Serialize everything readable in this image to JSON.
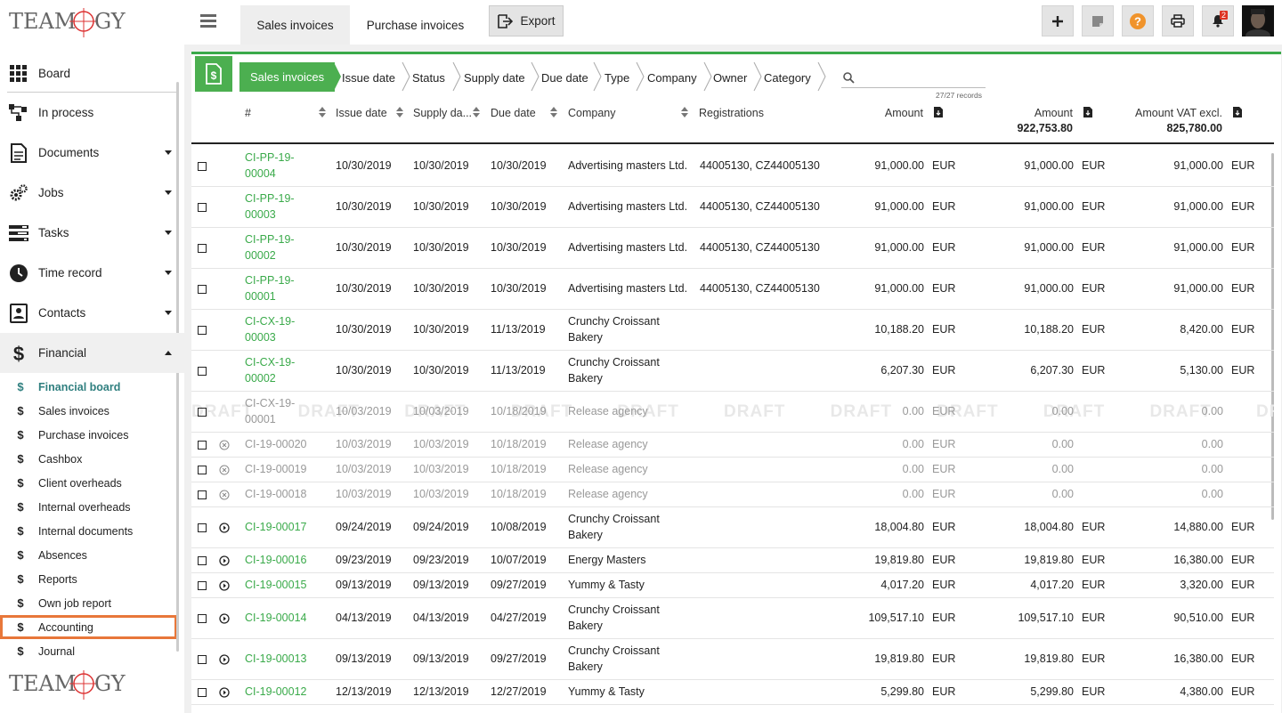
{
  "sidebar": {
    "logo_text": "TEAMOGY",
    "items": [
      {
        "label": "Board",
        "icon": "grid-icon",
        "caret": "none"
      },
      {
        "label": "In process",
        "icon": "flow-icon",
        "caret": "none"
      },
      {
        "label": "Documents",
        "icon": "document-icon",
        "caret": "down"
      },
      {
        "label": "Jobs",
        "icon": "gears-icon",
        "caret": "down"
      },
      {
        "label": "Tasks",
        "icon": "tasks-icon",
        "caret": "down"
      },
      {
        "label": "Time record",
        "icon": "clock-icon",
        "caret": "down"
      },
      {
        "label": "Contacts",
        "icon": "contact-icon",
        "caret": "down"
      },
      {
        "label": "Financial",
        "icon": "dollar-icon",
        "caret": "up"
      }
    ],
    "sub_items": [
      "Financial board",
      "Sales invoices",
      "Purchase invoices",
      "Cashbox",
      "Client overheads",
      "Internal overheads",
      "Internal documents",
      "Absences",
      "Reports",
      "Own job report",
      "Accounting",
      "Journal"
    ]
  },
  "topbar": {
    "tabs": [
      "Sales invoices",
      "Purchase invoices"
    ],
    "export_label": "Export",
    "notification_count": "2"
  },
  "filterbar": {
    "crumbs": [
      "Sales invoices",
      "Issue date",
      "Status",
      "Supply date",
      "Due date",
      "Type",
      "Company",
      "Owner",
      "Category"
    ],
    "search_placeholder": "",
    "records": "27/27 records"
  },
  "table": {
    "headers": {
      "number": "#",
      "issue_date": "Issue date",
      "supply_date": "Supply da...",
      "due_date": "Due date",
      "company": "Company",
      "registrations": "Registrations",
      "amount": "Amount",
      "amount2": "Amount",
      "amount2_total": "922,753.80",
      "amount_vat": "Amount VAT excl.",
      "amount_vat_total": "825,780.00"
    },
    "draft_word": "DRAFT",
    "rows": [
      {
        "num1": "CI-PP-19-",
        "num2": "00004",
        "issue": "10/30/2019",
        "supply": "10/30/2019",
        "due": "10/30/2019",
        "company1": "Advertising masters Ltd.",
        "company2": "",
        "reg": "44005130, CZ44005130",
        "amount": "91,000.00",
        "cur1": "EUR",
        "amount2": "91,000.00",
        "cur2": "EUR",
        "vat": "91,000.00",
        "cur3": "EUR",
        "status": "none",
        "grey": false
      },
      {
        "num1": "CI-PP-19-",
        "num2": "00003",
        "issue": "10/30/2019",
        "supply": "10/30/2019",
        "due": "10/30/2019",
        "company1": "Advertising masters Ltd.",
        "company2": "",
        "reg": "44005130, CZ44005130",
        "amount": "91,000.00",
        "cur1": "EUR",
        "amount2": "91,000.00",
        "cur2": "EUR",
        "vat": "91,000.00",
        "cur3": "EUR",
        "status": "none",
        "grey": false
      },
      {
        "num1": "CI-PP-19-",
        "num2": "00002",
        "issue": "10/30/2019",
        "supply": "10/30/2019",
        "due": "10/30/2019",
        "company1": "Advertising masters Ltd.",
        "company2": "",
        "reg": "44005130, CZ44005130",
        "amount": "91,000.00",
        "cur1": "EUR",
        "amount2": "91,000.00",
        "cur2": "EUR",
        "vat": "91,000.00",
        "cur3": "EUR",
        "status": "none",
        "grey": false
      },
      {
        "num1": "CI-PP-19-",
        "num2": "00001",
        "issue": "10/30/2019",
        "supply": "10/30/2019",
        "due": "10/30/2019",
        "company1": "Advertising masters Ltd.",
        "company2": "",
        "reg": "44005130, CZ44005130",
        "amount": "91,000.00",
        "cur1": "EUR",
        "amount2": "91,000.00",
        "cur2": "EUR",
        "vat": "91,000.00",
        "cur3": "EUR",
        "status": "none",
        "grey": false
      },
      {
        "num1": "CI-CX-19-",
        "num2": "00003",
        "issue": "10/30/2019",
        "supply": "10/30/2019",
        "due": "11/13/2019",
        "company1": "Crunchy Croissant",
        "company2": "Bakery",
        "reg": "",
        "amount": "10,188.20",
        "cur1": "EUR",
        "amount2": "10,188.20",
        "cur2": "EUR",
        "vat": "8,420.00",
        "cur3": "EUR",
        "status": "none",
        "grey": false
      },
      {
        "num1": "CI-CX-19-",
        "num2": "00002",
        "issue": "10/30/2019",
        "supply": "10/30/2019",
        "due": "11/13/2019",
        "company1": "Crunchy Croissant",
        "company2": "Bakery",
        "reg": "",
        "amount": "6,207.30",
        "cur1": "EUR",
        "amount2": "6,207.30",
        "cur2": "EUR",
        "vat": "5,130.00",
        "cur3": "EUR",
        "status": "none",
        "grey": false
      },
      {
        "num1": "CI-CX-19-",
        "num2": "00001",
        "issue": "10/03/2019",
        "supply": "10/03/2019",
        "due": "10/18/2019",
        "company1": "Release agency",
        "company2": "",
        "reg": "",
        "amount": "0.00",
        "cur1": "EUR",
        "amount2": "0.00",
        "cur2": "",
        "vat": "0.00",
        "cur3": "",
        "status": "draft",
        "grey": true
      },
      {
        "num1": "CI-19-00020",
        "num2": "",
        "issue": "10/03/2019",
        "supply": "10/03/2019",
        "due": "10/18/2019",
        "company1": "Release agency",
        "company2": "",
        "reg": "",
        "amount": "0.00",
        "cur1": "EUR",
        "amount2": "0.00",
        "cur2": "",
        "vat": "0.00",
        "cur3": "",
        "status": "cancelled",
        "grey": true
      },
      {
        "num1": "CI-19-00019",
        "num2": "",
        "issue": "10/03/2019",
        "supply": "10/03/2019",
        "due": "10/18/2019",
        "company1": "Release agency",
        "company2": "",
        "reg": "",
        "amount": "0.00",
        "cur1": "EUR",
        "amount2": "0.00",
        "cur2": "",
        "vat": "0.00",
        "cur3": "",
        "status": "cancelled",
        "grey": true
      },
      {
        "num1": "CI-19-00018",
        "num2": "",
        "issue": "10/03/2019",
        "supply": "10/03/2019",
        "due": "10/18/2019",
        "company1": "Release agency",
        "company2": "",
        "reg": "",
        "amount": "0.00",
        "cur1": "EUR",
        "amount2": "0.00",
        "cur2": "",
        "vat": "0.00",
        "cur3": "",
        "status": "cancelled",
        "grey": true
      },
      {
        "num1": "CI-19-00017",
        "num2": "",
        "issue": "09/24/2019",
        "supply": "09/24/2019",
        "due": "10/08/2019",
        "company1": "Crunchy Croissant",
        "company2": "Bakery",
        "reg": "",
        "amount": "18,004.80",
        "cur1": "EUR",
        "amount2": "18,004.80",
        "cur2": "EUR",
        "vat": "14,880.00",
        "cur3": "EUR",
        "status": "play",
        "grey": false
      },
      {
        "num1": "CI-19-00016",
        "num2": "",
        "issue": "09/23/2019",
        "supply": "09/23/2019",
        "due": "10/07/2019",
        "company1": "Energy Masters",
        "company2": "",
        "reg": "",
        "amount": "19,819.80",
        "cur1": "EUR",
        "amount2": "19,819.80",
        "cur2": "EUR",
        "vat": "16,380.00",
        "cur3": "EUR",
        "status": "play",
        "grey": false
      },
      {
        "num1": "CI-19-00015",
        "num2": "",
        "issue": "09/13/2019",
        "supply": "09/13/2019",
        "due": "09/27/2019",
        "company1": "Yummy & Tasty",
        "company2": "",
        "reg": "",
        "amount": "4,017.20",
        "cur1": "EUR",
        "amount2": "4,017.20",
        "cur2": "EUR",
        "vat": "3,320.00",
        "cur3": "EUR",
        "status": "play",
        "grey": false
      },
      {
        "num1": "CI-19-00014",
        "num2": "",
        "issue": "04/13/2019",
        "supply": "04/13/2019",
        "due": "04/27/2019",
        "company1": "Crunchy Croissant",
        "company2": "Bakery",
        "reg": "",
        "amount": "109,517.10",
        "cur1": "EUR",
        "amount2": "109,517.10",
        "cur2": "EUR",
        "vat": "90,510.00",
        "cur3": "EUR",
        "status": "play",
        "grey": false
      },
      {
        "num1": "CI-19-00013",
        "num2": "",
        "issue": "09/13/2019",
        "supply": "09/13/2019",
        "due": "09/27/2019",
        "company1": "Crunchy Croissant",
        "company2": "Bakery",
        "reg": "",
        "amount": "19,819.80",
        "cur1": "EUR",
        "amount2": "19,819.80",
        "cur2": "EUR",
        "vat": "16,380.00",
        "cur3": "EUR",
        "status": "play",
        "grey": false
      },
      {
        "num1": "CI-19-00012",
        "num2": "",
        "issue": "12/13/2019",
        "supply": "12/13/2019",
        "due": "12/27/2019",
        "company1": "Yummy & Tasty",
        "company2": "",
        "reg": "",
        "amount": "5,299.80",
        "cur1": "EUR",
        "amount2": "5,299.80",
        "cur2": "EUR",
        "vat": "4,380.00",
        "cur3": "EUR",
        "status": "play",
        "grey": false
      }
    ]
  }
}
